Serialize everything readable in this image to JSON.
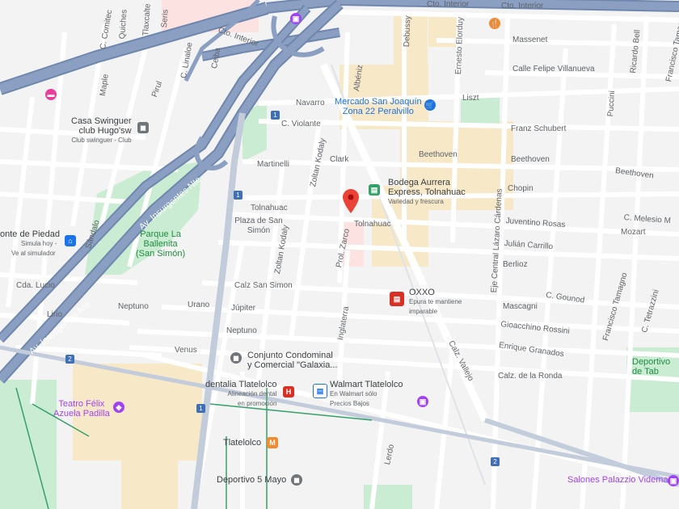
{
  "colors": {
    "background": "#f3f3f3",
    "highway": "#8a9fc2",
    "highway_edge": "#6f87ad",
    "street": "#ffffff",
    "block_tan": "#f7e8c8",
    "park": "#c9ecd2",
    "transit_green": "#35a06a",
    "pin": "#ea4335",
    "water_label_blue": "#1a73e8",
    "poi_purple": "#a142f4",
    "poi_pink": "#e93f9a",
    "poi_orange": "#f28b30",
    "poi_red": "#d93025",
    "poi_gray": "#70757a"
  },
  "streets": {
    "cto_interior_top": "Cto. Interior",
    "cto_interior_top2": "Cto. Interior",
    "cto_interior_mid": "Cto. Interior",
    "comitec": "C. Comitec",
    "quiches": "Quiches",
    "tlaxcaltecas": "Tlaxcalte",
    "seris": "Seris",
    "linaloe": "C. Linaloe",
    "ceiba": "Ceiba",
    "maple": "Maple",
    "pirul": "Pirul",
    "navarro": "Navarro",
    "c_violante": "C. Violante",
    "martinelli": "Martinelli",
    "clark": "Clark",
    "zoltan_kodaly": "Zoltan Kodaly",
    "zoltan_kodaly2": "Zoltan Kodaly",
    "zoltan_kodaly3": "Zoltan Kodaly",
    "debussy": "Debussy",
    "ernesto_elorduy": "Ernesto Elorduy",
    "albeniz": "Albéniz",
    "massenet": "Massenet",
    "felipe_villanueva": "Calle Felipe Villanueva",
    "liszt": "Liszt",
    "franz_schubert": "Franz Schubert",
    "beethoven1": "Beethoven",
    "beethoven2": "Beethoven",
    "beethoven3": "Beethoven",
    "chopin": "Chopin",
    "tolnahuac1": "Tolnahuac",
    "tolnahuac2": "Tolnahuac",
    "juventino_rosas": "Juventino Rosas",
    "julian_carrillo": "Julián Carrillo",
    "berlioz": "Berlioz",
    "c_melesio": "C. Melesio M",
    "mozart": "Mozart",
    "eje_central": "Eje Central Lázaro Cárdenas",
    "puccini": "Puccini",
    "ricardo_bell": "Ricardo Bell",
    "francisco_tamagno": "Francisco Tamagno",
    "francisco_tamagno2": "Francisco Tamagno",
    "c_gounod": "C. Gounod",
    "mascagni": "Mascagni",
    "gioacchino_rossini": "Gioacchino Rossini",
    "enrique_granados": "Enrique Granados",
    "c_tetrazzini": "C. Tetrazzini",
    "calz_de_la_ronda": "Calz. de la Ronda",
    "calz_vallejo": "Calz. Vallejo",
    "av_insurgentes_nte_top": "Av. Insurgentes Nte",
    "av_insurgentes_nte_bottom": "Av. Insurgentes Nte",
    "sandalo": "Sándalo",
    "cda_lucio": "Cda. Lucio",
    "lirio": "Lirio",
    "neptuno1": "Neptuno",
    "neptuno2": "Neptuno",
    "urano": "Urano",
    "jupiter": "Júpiter",
    "venus": "Venus",
    "calz_san_simon": "Calz San Simon",
    "prol_zarco": "Prol. Zarco",
    "inglaterra": "Inglaterra",
    "lerdo": "Lerdo",
    "plaza_san_simon": "Plaza de San Simón"
  },
  "places": {
    "mercado": {
      "line1": "Mercado San Joaquín",
      "line2": "Zona 22 Peralvillo"
    },
    "casa_swinguer": {
      "line1": "Casa Swinguer",
      "line2": "club Hugo'sw",
      "sub": "Club swinguer - Club"
    },
    "bodega": {
      "line1": "Bodega Aurrera",
      "line2": "Express, Tolnahuac",
      "sub": "Variedad y frescura"
    },
    "parque": {
      "line1": "Parque La",
      "line2": "Ballenita",
      "line3": "(San Simón)"
    },
    "monte_piedad": {
      "line1": "onte de Piedad",
      "sub1": "Simula hoy -",
      "sub2": "Ve al simulador"
    },
    "oxxo": {
      "line1": "OXXO",
      "sub1": "Epura te mantiene",
      "sub2": "imparable"
    },
    "conjunto": {
      "line1": "Conjunto Condominal",
      "line2": "y Comercial \"Galaxia..."
    },
    "dentalia": {
      "line1": "dentalia Tlatelolco",
      "sub1": "Alineación dental",
      "sub2": "en promoción"
    },
    "walmart": {
      "line1": "Walmart Tlatelolco",
      "sub1": "En Walmart sólo",
      "sub2": "Precios Bajos"
    },
    "teatro": {
      "line1": "Teatro Félix",
      "line2": "Azuela Padilla"
    },
    "tlatelolco": {
      "line1": "Tlatelolco"
    },
    "deportivo_5_mayo": {
      "line1": "Deportivo 5 Mayo"
    },
    "deportivo_tab": {
      "line1": "Deportivo",
      "line2": "de Tab"
    },
    "salones": {
      "line1": "Salones Palazzio Videmar"
    }
  },
  "route_shields": {
    "s1": "1",
    "s2": "1",
    "s3": "1",
    "s4": "2",
    "s5": "2"
  },
  "icons": {
    "pin": "red-location-pin-icon",
    "market": "shopping-cart-icon",
    "store": "store-icon",
    "hospital": "hospital-icon",
    "metro": "metro-station-icon",
    "theater": "theater-icon",
    "hotel": "hotel-icon",
    "restaurant": "restaurant-icon",
    "photo": "camera-icon",
    "landmark": "landmark-icon",
    "bank": "bank-icon"
  },
  "glyphs": {
    "restaurant": "🍴",
    "hotel": "▬",
    "market": "🛒",
    "landmark": "◼",
    "hospital": "H",
    "metro": "M",
    "bank": "⌂",
    "store": "▤",
    "camera": "▣",
    "theater": "◆"
  }
}
